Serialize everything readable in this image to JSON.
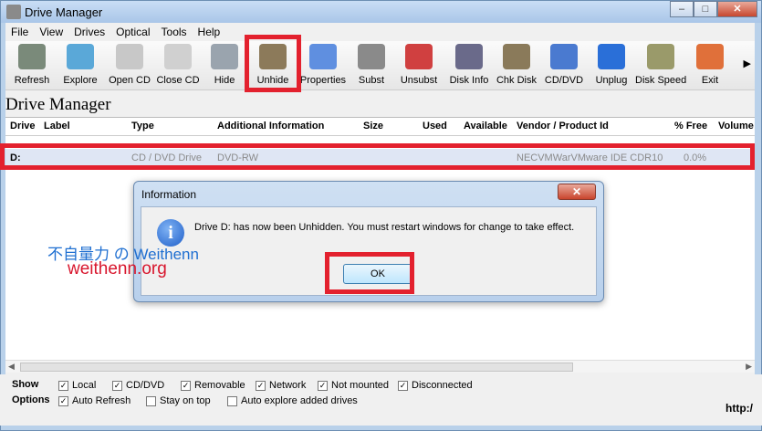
{
  "window": {
    "title": "Drive Manager",
    "controls": [
      "–",
      "□",
      "✕"
    ]
  },
  "menu": [
    "File",
    "View",
    "Drives",
    "Optical",
    "Tools",
    "Help"
  ],
  "toolbar": [
    {
      "label": "Refresh",
      "icon": "refresh-icon",
      "color": "#7a8a7a"
    },
    {
      "label": "Explore",
      "icon": "explore-icon",
      "color": "#5aa8d8"
    },
    {
      "label": "Open CD",
      "icon": "open-cd-icon",
      "color": "#c8c8c8"
    },
    {
      "label": "Close CD",
      "icon": "close-cd-icon",
      "color": "#d0d0d0"
    },
    {
      "label": "Hide",
      "icon": "hide-icon",
      "color": "#9aa4ae"
    },
    {
      "label": "Unhide",
      "icon": "unhide-icon",
      "color": "#8c7a5a"
    },
    {
      "label": "Properties",
      "icon": "properties-icon",
      "color": "#5f8fe0"
    },
    {
      "label": "Subst",
      "icon": "subst-icon",
      "color": "#8a8a8a"
    },
    {
      "label": "Unsubst",
      "icon": "unsubst-icon",
      "color": "#d04040"
    },
    {
      "label": "Disk Info",
      "icon": "disk-info-icon",
      "color": "#6a6a8a"
    },
    {
      "label": "Chk Disk",
      "icon": "chk-disk-icon",
      "color": "#8a7a5a"
    },
    {
      "label": "CD/DVD",
      "icon": "cd-dvd-icon",
      "color": "#4a7ad0"
    },
    {
      "label": "Unplug",
      "icon": "unplug-icon",
      "color": "#2a6fd8"
    },
    {
      "label": "Disk Speed",
      "icon": "disk-speed-icon",
      "color": "#9a9a6a"
    },
    {
      "label": "Exit",
      "icon": "exit-icon",
      "color": "#e0703a"
    }
  ],
  "section_title": "Drive Manager",
  "columns": [
    "Drive",
    "Label",
    "Type",
    "Additional Information",
    "Size",
    "Used",
    "Available",
    "Vendor / Product Id",
    "% Free",
    "Volume"
  ],
  "row": {
    "drive": "D:",
    "label": "",
    "type": "CD / DVD Drive",
    "info": "DVD-RW",
    "vendor": "NECVMWarVMware IDE CDR10",
    "free": "0.0%"
  },
  "options": {
    "show_label": "Show",
    "show_items": [
      {
        "label": "Local",
        "checked": true
      },
      {
        "label": "CD/DVD",
        "checked": true
      },
      {
        "label": "Removable",
        "checked": true
      },
      {
        "label": "Network",
        "checked": true
      },
      {
        "label": "Not mounted",
        "checked": true
      },
      {
        "label": "Disconnected",
        "checked": true
      }
    ],
    "options_label": "Options",
    "option_items": [
      {
        "label": "Auto Refresh",
        "checked": true
      },
      {
        "label": "Stay on top",
        "checked": false
      },
      {
        "label": "Auto explore added drives",
        "checked": false
      }
    ]
  },
  "status_text": "http:/",
  "dialog": {
    "title": "Information",
    "message": "Drive D: has now been Unhidden. You must restart windows for change to take effect.",
    "ok": "OK",
    "icon": "info-icon"
  },
  "watermark": {
    "line1": "不自量力 の Weithenn",
    "line2": "weithenn.org"
  },
  "colors": {
    "highlight": "#e3212e",
    "selected_row": "#dfe6f4"
  }
}
